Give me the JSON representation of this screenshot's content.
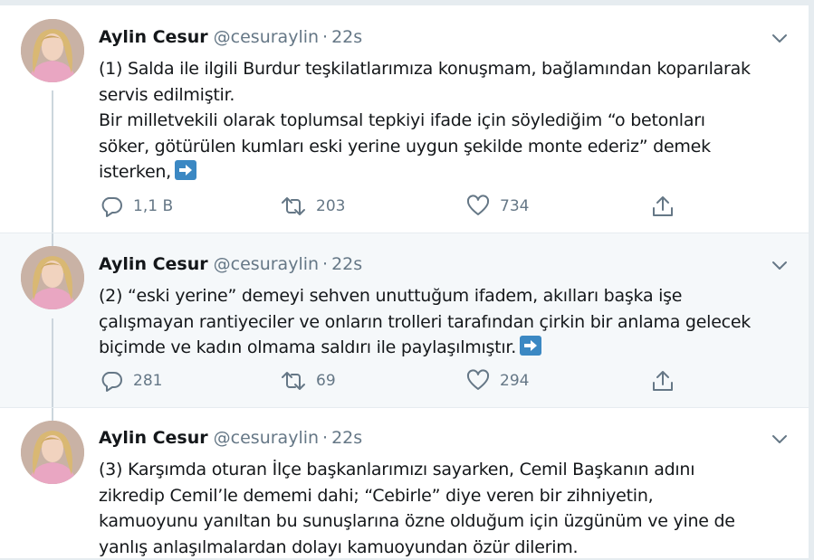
{
  "tweets": [
    {
      "name": "Aylin Cesur",
      "handle": "@cesuraylin",
      "time": "22s",
      "lines": [
        "(1) Salda ile ilgili Burdur teşkilatlarımıza konuşmam, bağlamından koparılarak",
        "servis edilmiştir.",
        "Bir milletvekili olarak toplumsal tepkiyi ifade için söylediğim “o betonları",
        "söker, götürülen kumları eski yerine uygun şekilde monte ederiz” demek",
        "isterken,"
      ],
      "replies": "1,1 B",
      "retweets": "203",
      "likes": "734"
    },
    {
      "name": "Aylin Cesur",
      "handle": "@cesuraylin",
      "time": "22s",
      "lines": [
        "(2) “eski yerine” demeyi sehven unuttuğum ifadem, akılları başka işe",
        "çalışmayan rantiyeciler ve onların trolleri tarafından çirkin bir anlama gelecek",
        "biçimde ve kadın olmama saldırı ile paylaşılmıştır."
      ],
      "replies": "281",
      "retweets": "69",
      "likes": "294"
    },
    {
      "name": "Aylin Cesur",
      "handle": "@cesuraylin",
      "time": "22s",
      "lines": [
        "(3) Karşımda oturan İlçe başkanlarımızı sayarken, Cemil Başkanın adını",
        "zikredip Cemil’le dememi dahi; “Cebirle” diye veren bir zihniyetin,",
        "kamuoyunu yanıltan bu sunuşlarına özne olduğum için üzgünüm ve yine de",
        "yanlış anlaşılmalardan dolayı kamuoyundan özür dilerim."
      ]
    }
  ],
  "icons": {
    "reply": "reply-icon",
    "retweet": "retweet-icon",
    "like": "heart-icon",
    "share": "share-icon",
    "caret": "chevron-down-icon",
    "emoji": "right-arrow-emoji-icon"
  },
  "colors": {
    "icon_gray": "#657786",
    "thread_line": "#ccd6dd",
    "emoji_blue": "#3b88c3",
    "highlight_bg": "#f5f8fa"
  }
}
